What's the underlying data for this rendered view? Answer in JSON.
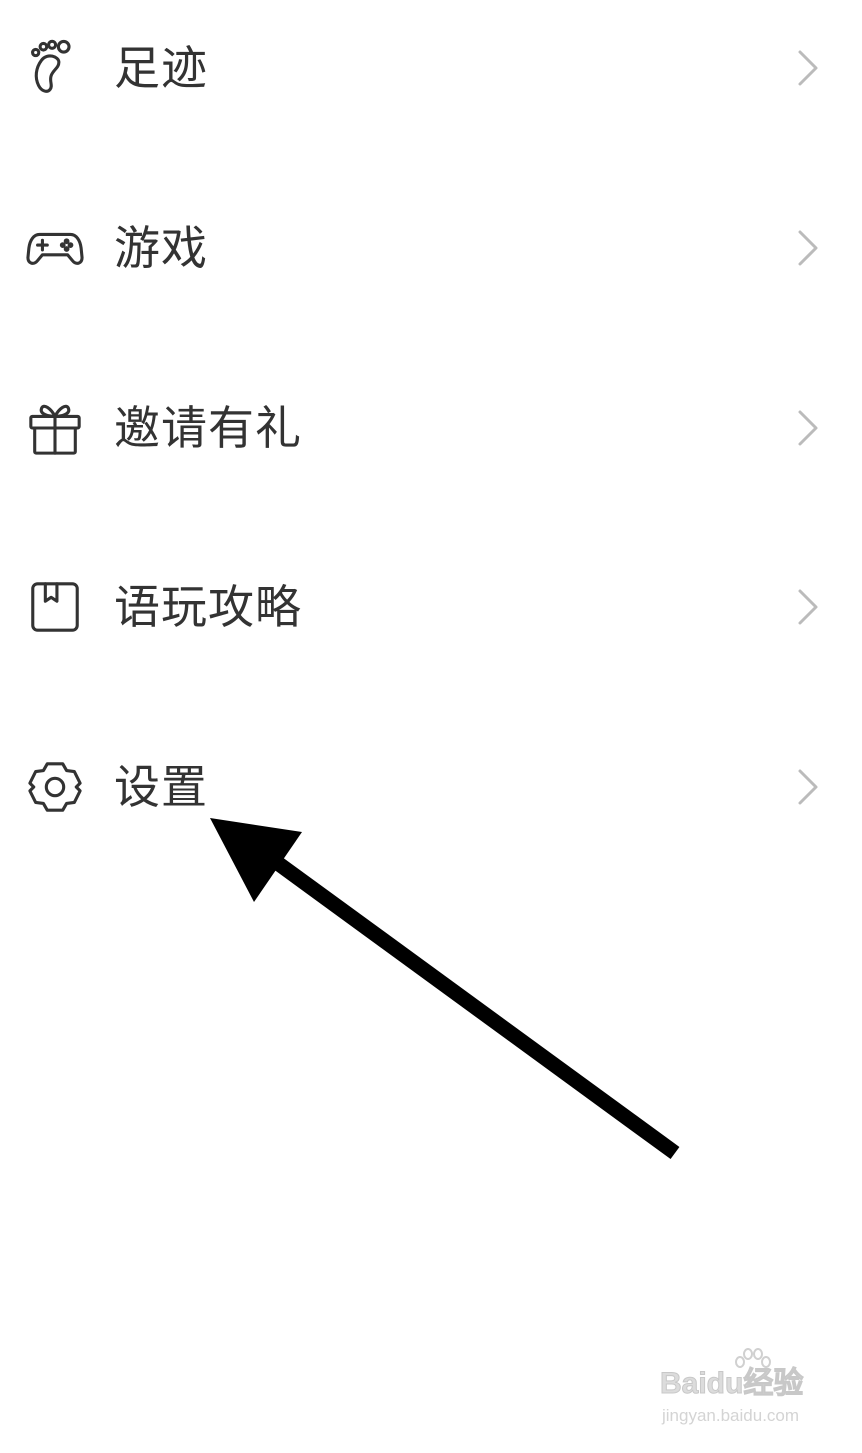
{
  "menu": {
    "items": [
      {
        "label": "足迹",
        "icon": "footprint-icon"
      },
      {
        "label": "游戏",
        "icon": "gamepad-icon"
      },
      {
        "label": "邀请有礼",
        "icon": "gift-icon"
      },
      {
        "label": "语玩攻略",
        "icon": "guide-book-icon"
      },
      {
        "label": "设置",
        "icon": "gear-icon"
      }
    ],
    "chevron_icon": "chevron-right-icon"
  },
  "annotation": {
    "icon": "arrow-annotation",
    "color": "#000000"
  },
  "watermark": {
    "logo": "Baidu经验",
    "url": "jingyan.baidu.com"
  },
  "colors": {
    "text": "#333333",
    "icon": "#333333",
    "chevron": "#bbbbbb",
    "background": "#ffffff"
  }
}
